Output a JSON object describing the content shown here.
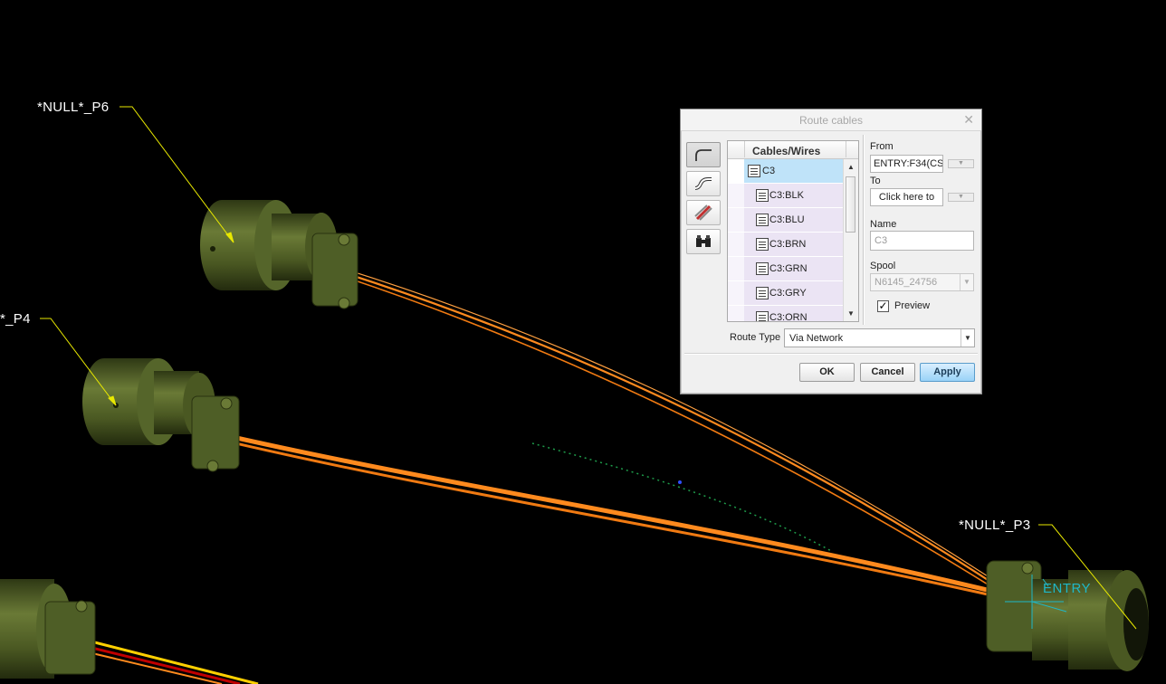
{
  "viewport": {
    "callouts": {
      "p6": "*NULL*_P6",
      "p4": "*_P4",
      "p3": "*NULL*_P3"
    },
    "entry_label": "ENTRY",
    "colors": {
      "background": "#000000",
      "connector": "#55652a",
      "cable": "#ff8a1e",
      "callout_leader": "#e8e800",
      "csys": "#1fb8c8"
    }
  },
  "dialog": {
    "title": "Route cables",
    "tools": [
      "route-icon",
      "pipe-route-icon",
      "cable-bundle-icon",
      "find-icon"
    ],
    "list": {
      "header": "Cables/Wires",
      "items": [
        {
          "label": "C3",
          "selected": true
        },
        {
          "label": "C3:BLK"
        },
        {
          "label": "C3:BLU"
        },
        {
          "label": "C3:BRN"
        },
        {
          "label": "C3:GRN"
        },
        {
          "label": "C3:GRY"
        },
        {
          "label": "C3:ORN"
        }
      ]
    },
    "from_label": "From",
    "from_value": "ENTRY:F34(CS'",
    "to_label": "To",
    "to_value": "Click here to",
    "name_label": "Name",
    "name_placeholder": "C3",
    "spool_label": "Spool",
    "spool_value": "N6145_24756",
    "preview_label": "Preview",
    "preview_checked": true,
    "route_type_label": "Route Type",
    "route_type_value": "Via Network",
    "ok_label": "OK",
    "cancel_label": "Cancel",
    "apply_label": "Apply"
  }
}
